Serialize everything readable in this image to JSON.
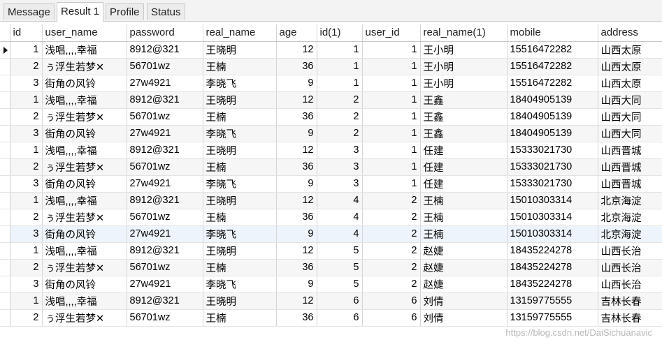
{
  "tabs": [
    {
      "label": "Message",
      "active": false
    },
    {
      "label": "Result 1",
      "active": true
    },
    {
      "label": "Profile",
      "active": false
    },
    {
      "label": "Status",
      "active": false
    }
  ],
  "columns": [
    "id",
    "user_name",
    "password",
    "real_name",
    "age",
    "id(1)",
    "user_id",
    "real_name(1)",
    "mobile",
    "address"
  ],
  "rows": [
    [
      "1",
      "浅唱,,,,幸福",
      "8912@321",
      "王晓明",
      "12",
      "1",
      "1",
      "王小明",
      "15516472282",
      "山西太原"
    ],
    [
      "2",
      "ぅ浮生若梦✕",
      "56701wz",
      "王楠",
      "36",
      "1",
      "1",
      "王小明",
      "15516472282",
      "山西太原"
    ],
    [
      "3",
      "街角の风铃",
      "27w4921",
      "李晓飞",
      "9",
      "1",
      "1",
      "王小明",
      "15516472282",
      "山西太原"
    ],
    [
      "1",
      "浅唱,,,,幸福",
      "8912@321",
      "王晓明",
      "12",
      "2",
      "1",
      "王鑫",
      "18404905139",
      "山西大同"
    ],
    [
      "2",
      "ぅ浮生若梦✕",
      "56701wz",
      "王楠",
      "36",
      "2",
      "1",
      "王鑫",
      "18404905139",
      "山西大同"
    ],
    [
      "3",
      "街角の风铃",
      "27w4921",
      "李晓飞",
      "9",
      "2",
      "1",
      "王鑫",
      "18404905139",
      "山西大同"
    ],
    [
      "1",
      "浅唱,,,,幸福",
      "8912@321",
      "王晓明",
      "12",
      "3",
      "1",
      "任建",
      "15333021730",
      "山西晋城"
    ],
    [
      "2",
      "ぅ浮生若梦✕",
      "56701wz",
      "王楠",
      "36",
      "3",
      "1",
      "任建",
      "15333021730",
      "山西晋城"
    ],
    [
      "3",
      "街角の风铃",
      "27w4921",
      "李晓飞",
      "9",
      "3",
      "1",
      "任建",
      "15333021730",
      "山西晋城"
    ],
    [
      "1",
      "浅唱,,,,幸福",
      "8912@321",
      "王晓明",
      "12",
      "4",
      "2",
      "王楠",
      "15010303314",
      "北京海淀"
    ],
    [
      "2",
      "ぅ浮生若梦✕",
      "56701wz",
      "王楠",
      "36",
      "4",
      "2",
      "王楠",
      "15010303314",
      "北京海淀"
    ],
    [
      "3",
      "街角の风铃",
      "27w4921",
      "李晓飞",
      "9",
      "4",
      "2",
      "王楠",
      "15010303314",
      "北京海淀"
    ],
    [
      "1",
      "浅唱,,,,幸福",
      "8912@321",
      "王晓明",
      "12",
      "5",
      "2",
      "赵婕",
      "18435224278",
      "山西长治"
    ],
    [
      "2",
      "ぅ浮生若梦✕",
      "56701wz",
      "王楠",
      "36",
      "5",
      "2",
      "赵婕",
      "18435224278",
      "山西长治"
    ],
    [
      "3",
      "街角の风铃",
      "27w4921",
      "李晓飞",
      "9",
      "5",
      "2",
      "赵婕",
      "18435224278",
      "山西长治"
    ],
    [
      "1",
      "浅唱,,,,幸福",
      "8912@321",
      "王晓明",
      "12",
      "6",
      "6",
      "刘倩",
      "13159775555",
      "吉林长春"
    ],
    [
      "2",
      "ぅ浮生若梦✕",
      "56701wz",
      "王楠",
      "36",
      "6",
      "6",
      "刘倩",
      "13159775555",
      "吉林长春"
    ]
  ],
  "watermark": "https://blog.csdn.net/DaiSichuanavic"
}
